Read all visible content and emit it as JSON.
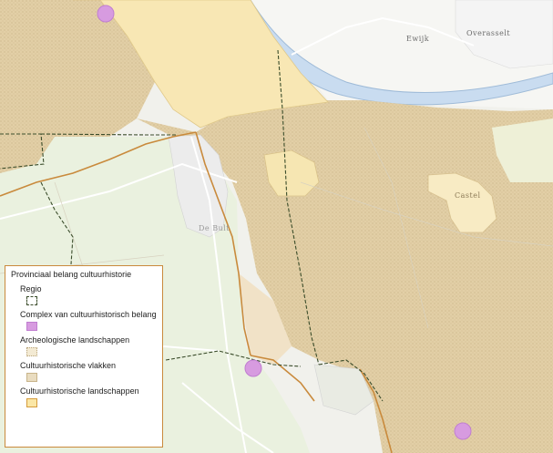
{
  "map": {
    "place_labels": {
      "ewijk": "Ewijk",
      "overasselt": "Overasselt",
      "de_bult": "De Bult",
      "castel": "Castel"
    }
  },
  "legend": {
    "title": "Provinciaal belang cultuurhistorie",
    "items": [
      {
        "label": "Regio",
        "icon": "dashed-outline-square",
        "color": "#3b4d2b"
      },
      {
        "label": "Complex van cultuurhistorisch belang",
        "icon": "filled-square",
        "color": "#d79be0"
      },
      {
        "label": "Archeologische landschappen",
        "icon": "dotted-square",
        "color": "#f3ead3"
      },
      {
        "label": "Cultuurhistorische vlakken",
        "icon": "filled-square",
        "color": "#e9dcc0"
      },
      {
        "label": "Cultuurhistorische landschappen",
        "icon": "outlined-square",
        "color": "#fbe7a6"
      }
    ]
  },
  "colors": {
    "river": "#c9dcf0",
    "forest_texture": "#d8c29a",
    "landscape_fill": "#f8e7b4",
    "boundary": "#c98a3c",
    "regio_line": "#3b4d2b"
  }
}
